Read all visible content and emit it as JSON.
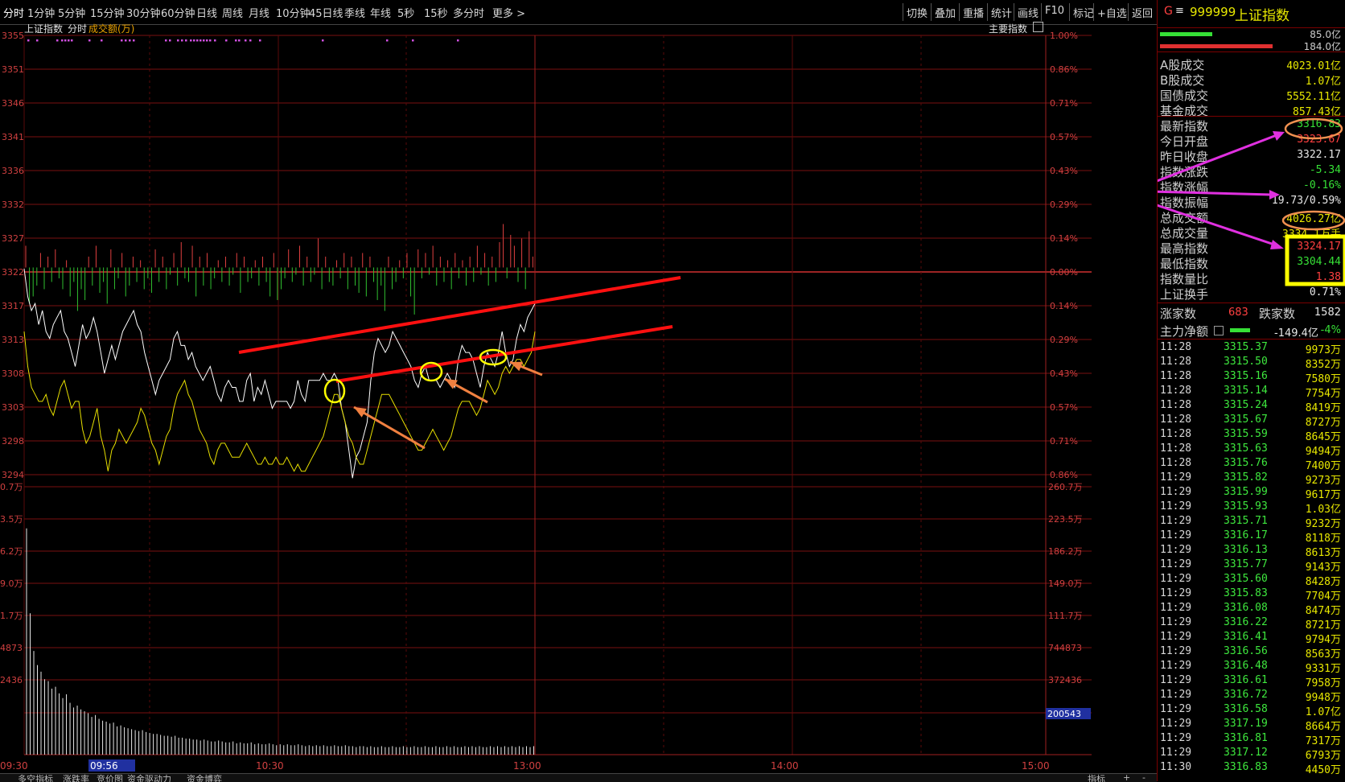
{
  "toolbar": {
    "periods": [
      "分时",
      "1分钟",
      "5分钟",
      "15分钟",
      "30分钟",
      "60分钟",
      "日线",
      "周线",
      "月线",
      "10分钟",
      "45日线",
      "季线",
      "年线",
      "5秒",
      "15秒",
      "多分时",
      "更多 >"
    ],
    "right_tools": [
      "切换",
      "叠加",
      "重播",
      "统计",
      "画线",
      "F10",
      "标记",
      "+自选",
      "返回"
    ]
  },
  "chart_header": {
    "index_name": "上证指数",
    "mode": "分时",
    "volume_label": "成交额(万)",
    "main_index": "主要指数"
  },
  "chart_data": {
    "type": "line",
    "title": "上证指数 分时",
    "x_labels": [
      "09:30",
      "10:30",
      "13:00",
      "14:00",
      "15:00"
    ],
    "cursor_time": "09:56",
    "price_axis_left": [
      "3355",
      "3351",
      "3346",
      "3341",
      "3336",
      "3332",
      "3327",
      "3322",
      "3317",
      "3313",
      "3308",
      "3303",
      "3298",
      "3294"
    ],
    "percent_axis_right": [
      "1.00%",
      "0.86%",
      "0.71%",
      "0.57%",
      "0.43%",
      "0.29%",
      "0.14%",
      "0.00%",
      "0.14%",
      "0.29%",
      "0.43%",
      "0.57%",
      "0.71%",
      "0.86%"
    ],
    "volume_axis_left": [
      "0.7万",
      "3.5万",
      "6.2万",
      "9.0万",
      "1.7万",
      "4873",
      "2436"
    ],
    "volume_axis_right": [
      "260.7万",
      "223.5万",
      "186.2万",
      "149.0万",
      "111.7万",
      "744873",
      "372436"
    ],
    "volume_cursor_value": "200543",
    "price_range": [
      3292.5,
      3355.4
    ],
    "prev_close": 3322.17,
    "series": [
      {
        "name": "上证指数",
        "color": "#ffffff",
        "values": [
          3322,
          3318,
          3316,
          3317,
          3314,
          3316,
          3313,
          3312,
          3314,
          3315,
          3316,
          3313,
          3312,
          3310,
          3308,
          3311,
          3314,
          3312,
          3313,
          3315,
          3313,
          3310,
          3307,
          3309,
          3311,
          3309,
          3311,
          3313,
          3314,
          3315,
          3316,
          3314,
          3313,
          3310,
          3308,
          3306,
          3304,
          3306,
          3307,
          3308,
          3309,
          3312,
          3313,
          3311,
          3311,
          3309,
          3310,
          3308,
          3307,
          3306,
          3307,
          3308,
          3306,
          3304,
          3303,
          3305,
          3306,
          3305,
          3305,
          3303,
          3303,
          3306,
          3307,
          3303,
          3305,
          3304,
          3306,
          3304,
          3302,
          3303,
          3303,
          3303,
          3303,
          3302,
          3303,
          3306,
          3304,
          3303,
          3306,
          3306,
          3306,
          3306,
          3307,
          3306,
          3306,
          3307,
          3306,
          3302,
          3300,
          3296,
          3292,
          3295,
          3296,
          3298,
          3300,
          3306,
          3310,
          3312,
          3311,
          3310,
          3311,
          3313,
          3312,
          3311,
          3310,
          3309,
          3308,
          3306,
          3305,
          3307,
          3308,
          3306,
          3306,
          3306,
          3305,
          3306,
          3307,
          3306,
          3305,
          3309,
          3311,
          3310,
          3310,
          3309,
          3307,
          3305,
          3308,
          3310,
          3309,
          3308,
          3310,
          3313,
          3310,
          3308,
          3309,
          3312,
          3314,
          3313,
          3315,
          3316,
          3317
        ]
      },
      {
        "name": "均线",
        "color": "#e8e000",
        "values": [
          3313,
          3308,
          3305,
          3304,
          3303,
          3303,
          3304,
          3302,
          3301,
          3303,
          3305,
          3306,
          3304,
          3302,
          3303,
          3303,
          3299,
          3297,
          3298,
          3300,
          3302,
          3298,
          3296,
          3293,
          3296,
          3297,
          3299,
          3298,
          3297,
          3298,
          3299,
          3300,
          3302,
          3301,
          3299,
          3297,
          3296,
          3294,
          3296,
          3298,
          3299,
          3302,
          3304,
          3305,
          3306,
          3304,
          3303,
          3301,
          3299,
          3298,
          3297,
          3295,
          3294,
          3296,
          3297,
          3297,
          3296,
          3295,
          3295,
          3295,
          3296,
          3297,
          3296,
          3295,
          3294,
          3294,
          3295,
          3294,
          3294,
          3295,
          3294,
          3294,
          3295,
          3294,
          3293,
          3294,
          3293,
          3293,
          3294,
          3295,
          3296,
          3297,
          3298,
          3300,
          3302,
          3304,
          3304,
          3302,
          3300,
          3298,
          3297,
          3295,
          3294,
          3294,
          3296,
          3298,
          3300,
          3302,
          3304,
          3304,
          3304,
          3303,
          3302,
          3301,
          3300,
          3299,
          3298,
          3297,
          3296,
          3296,
          3297,
          3298,
          3299,
          3298,
          3297,
          3296,
          3297,
          3298,
          3300,
          3302,
          3303,
          3303,
          3303,
          3302,
          3301,
          3302,
          3304,
          3306,
          3305,
          3304,
          3305,
          3307,
          3308,
          3307,
          3308,
          3309,
          3309,
          3308,
          3309,
          3310,
          3313
        ]
      }
    ],
    "bars_diff": [
      6,
      -10,
      -8,
      -5,
      4,
      -6,
      3,
      -4,
      5,
      -3,
      -6,
      2,
      -8,
      -4,
      -12,
      -6,
      -9,
      3,
      -5,
      6,
      -7,
      -4,
      -10,
      5,
      -6,
      -3,
      4,
      -8,
      -5,
      3,
      -4,
      2,
      -6,
      -3,
      -7,
      5,
      -4,
      3,
      -6,
      -2,
      4,
      -5,
      7,
      -3,
      -4,
      6,
      -8,
      3,
      -5,
      4,
      -6,
      -3,
      2,
      -4,
      3,
      -5,
      -2,
      4,
      -7,
      3,
      -4,
      -3,
      2,
      -5,
      3,
      -4,
      -8,
      4,
      -9,
      -6,
      -3,
      5,
      -4,
      -2,
      6,
      -5,
      3,
      -4,
      -2,
      8,
      -6,
      3,
      -4,
      -5,
      2,
      -3,
      4,
      -6,
      3,
      -5,
      -7,
      4,
      -8,
      3,
      -4,
      -9,
      -5,
      -12,
      3,
      -6,
      -4,
      2,
      -3,
      4,
      -8,
      -13,
      5,
      -3,
      4,
      -2,
      6,
      -5,
      3,
      -4,
      2,
      -6,
      4,
      -3,
      2,
      -5,
      3,
      -4,
      6,
      -2,
      4,
      -5,
      3,
      -4,
      7,
      12,
      -3,
      9,
      6,
      -4,
      8,
      -6,
      10,
      3
    ],
    "volume": [
      240,
      150,
      110,
      95,
      88,
      80,
      78,
      70,
      72,
      65,
      60,
      64,
      55,
      50,
      52,
      48,
      46,
      44,
      40,
      42,
      38,
      36,
      35,
      33,
      34,
      30,
      31,
      29,
      28,
      27,
      26,
      25,
      26,
      24,
      23,
      22,
      22,
      21,
      20,
      20,
      19,
      20,
      18,
      18,
      17,
      17,
      16,
      16,
      15,
      16,
      15,
      14,
      14,
      15,
      14,
      13,
      13,
      14,
      12,
      13,
      12,
      12,
      13,
      11,
      12,
      11,
      11,
      12,
      11,
      10,
      11,
      10,
      11,
      10,
      10,
      11,
      10,
      9,
      10,
      9,
      10,
      9,
      10,
      9,
      9,
      10,
      9,
      9,
      10,
      9,
      9,
      8,
      9,
      9,
      8,
      9,
      8,
      8,
      9,
      8,
      8,
      9,
      8,
      8,
      9,
      8,
      8,
      9,
      8,
      8,
      9,
      8,
      8,
      9,
      8,
      8,
      9,
      8,
      9,
      8,
      8,
      9,
      8,
      9,
      8,
      9,
      8,
      8,
      9,
      8,
      9,
      8,
      9,
      8,
      9,
      8,
      9,
      8,
      9,
      8,
      9
    ]
  },
  "sidebar": {
    "header_symbol": "G",
    "header_code": "999999",
    "header_name": "上证指数",
    "strength_values": [
      "85.0亿",
      "184.0亿"
    ],
    "stats": [
      {
        "label": "A股成交",
        "value": "4023.01亿",
        "color": "#e8e800"
      },
      {
        "label": "B股成交",
        "value": "1.07亿",
        "color": "#e8e800"
      },
      {
        "label": "国债成交",
        "value": "5552.11亿",
        "color": "#e8e800"
      },
      {
        "label": "基金成交",
        "value": "857.43亿",
        "color": "#e8e800"
      },
      {
        "label": "最新指数",
        "value": "3316.83",
        "color": "#36e036"
      },
      {
        "label": "今日开盘",
        "value": "3323.67",
        "color": "#ff4040"
      },
      {
        "label": "昨日收盘",
        "value": "3322.17",
        "color": "#e8e8e8"
      },
      {
        "label": "指数涨跌",
        "value": "-5.34",
        "color": "#36e036"
      },
      {
        "label": "指数涨幅",
        "value": "-0.16%",
        "color": "#36e036"
      },
      {
        "label": "指数振幅",
        "value": "19.73/0.59%",
        "color": "#e8e8e8"
      },
      {
        "label": "总成交额",
        "value": "4026.27亿",
        "color": "#e8e800"
      },
      {
        "label": "总成交量",
        "value": "3334.1万手",
        "color": "#e8e800"
      },
      {
        "label": "最高指数",
        "value": "3324.17",
        "color": "#ff4040"
      },
      {
        "label": "最低指数",
        "value": "3304.44",
        "color": "#36e036"
      },
      {
        "label": "指数量比",
        "value": "1.38",
        "color": "#ff4040"
      },
      {
        "label": "上证换手",
        "value": "0.71%",
        "color": "#e8e8e8"
      }
    ],
    "up_label": "涨家数",
    "up_count": "683",
    "down_label": "跌家数",
    "down_count": "1582",
    "main_net_label": "主力净额",
    "main_net_value": "-149.4亿",
    "main_net_pct": "-4%",
    "ticks": [
      {
        "t": "11:28",
        "p": "3315.37",
        "v": "9973万"
      },
      {
        "t": "11:28",
        "p": "3315.50",
        "v": "8352万"
      },
      {
        "t": "11:28",
        "p": "3315.16",
        "v": "7580万"
      },
      {
        "t": "11:28",
        "p": "3315.14",
        "v": "7754万"
      },
      {
        "t": "11:28",
        "p": "3315.24",
        "v": "8419万"
      },
      {
        "t": "11:28",
        "p": "3315.67",
        "v": "8727万"
      },
      {
        "t": "11:28",
        "p": "3315.59",
        "v": "8645万"
      },
      {
        "t": "11:28",
        "p": "3315.63",
        "v": "9494万"
      },
      {
        "t": "11:28",
        "p": "3315.76",
        "v": "7400万"
      },
      {
        "t": "11:29",
        "p": "3315.82",
        "v": "9273万"
      },
      {
        "t": "11:29",
        "p": "3315.99",
        "v": "9617万"
      },
      {
        "t": "11:29",
        "p": "3315.93",
        "v": "1.03亿"
      },
      {
        "t": "11:29",
        "p": "3315.71",
        "v": "9232万"
      },
      {
        "t": "11:29",
        "p": "3316.17",
        "v": "8118万"
      },
      {
        "t": "11:29",
        "p": "3316.13",
        "v": "8613万"
      },
      {
        "t": "11:29",
        "p": "3315.77",
        "v": "9143万"
      },
      {
        "t": "11:29",
        "p": "3315.60",
        "v": "8428万"
      },
      {
        "t": "11:29",
        "p": "3315.83",
        "v": "7704万"
      },
      {
        "t": "11:29",
        "p": "3316.08",
        "v": "8474万"
      },
      {
        "t": "11:29",
        "p": "3316.22",
        "v": "8721万"
      },
      {
        "t": "11:29",
        "p": "3316.41",
        "v": "9794万"
      },
      {
        "t": "11:29",
        "p": "3316.56",
        "v": "8563万"
      },
      {
        "t": "11:29",
        "p": "3316.48",
        "v": "9331万"
      },
      {
        "t": "11:29",
        "p": "3316.61",
        "v": "7958万"
      },
      {
        "t": "11:29",
        "p": "3316.72",
        "v": "9948万"
      },
      {
        "t": "11:29",
        "p": "3316.58",
        "v": "1.07亿"
      },
      {
        "t": "11:29",
        "p": "3317.19",
        "v": "8664万"
      },
      {
        "t": "11:29",
        "p": "3316.81",
        "v": "7317万"
      },
      {
        "t": "11:29",
        "p": "3317.12",
        "v": "6793万"
      },
      {
        "t": "11:30",
        "p": "3316.83",
        "v": "4450万"
      }
    ]
  },
  "bottom_tabs": [
    "多空指标",
    "涨跌率",
    "竞价图",
    "资金驱动力",
    "资金博弈"
  ],
  "bottom_right": [
    "指标",
    "+",
    "-"
  ]
}
